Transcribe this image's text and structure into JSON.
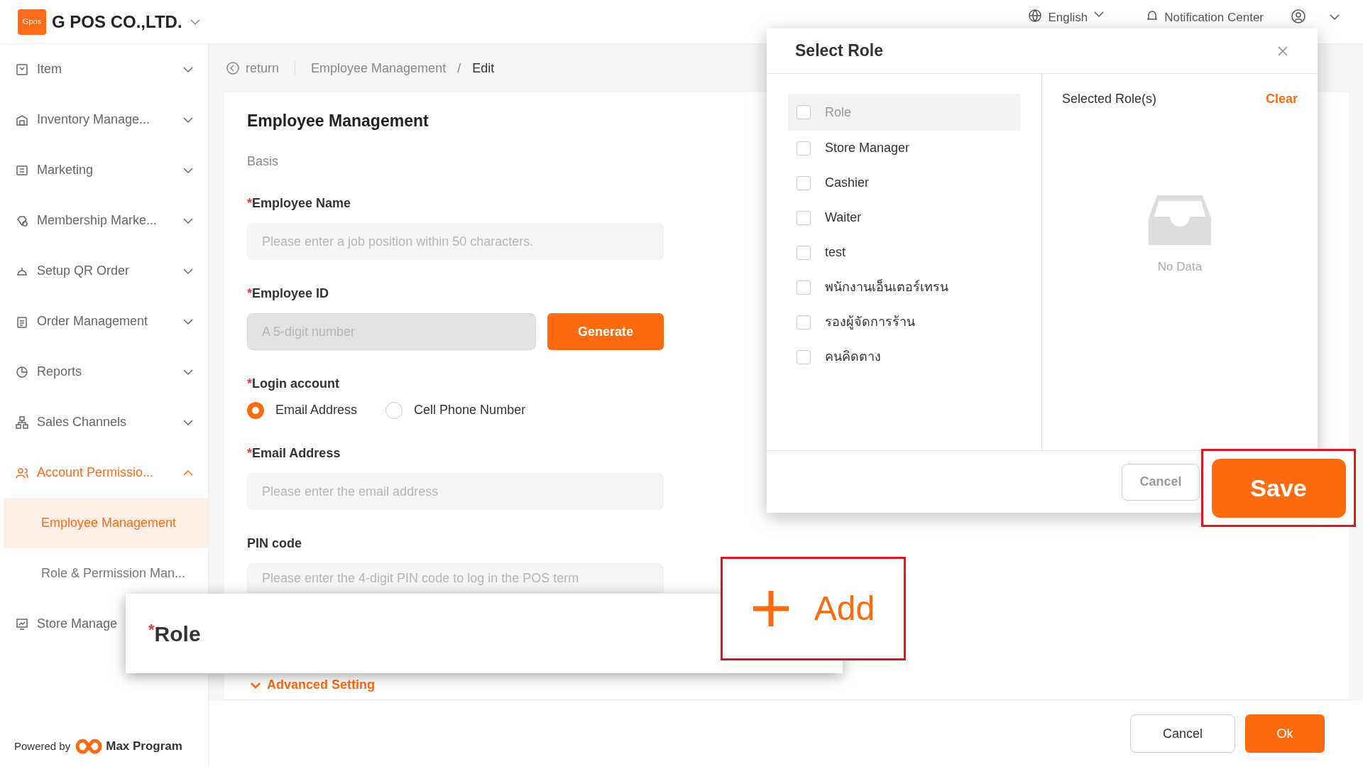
{
  "header": {
    "logo_text": "Gpos",
    "company": "G POS CO.,LTD.",
    "language": "English",
    "notification": "Notification Center"
  },
  "sidebar": {
    "items": [
      {
        "label": "Item",
        "expanded": false,
        "selected": false
      },
      {
        "label": "Inventory Manage...",
        "expanded": false,
        "selected": false
      },
      {
        "label": "Marketing",
        "expanded": false,
        "selected": false
      },
      {
        "label": "Membership Marke...",
        "expanded": false,
        "selected": false
      },
      {
        "label": "Setup QR Order",
        "expanded": false,
        "selected": false
      },
      {
        "label": "Order Management",
        "expanded": false,
        "selected": false
      },
      {
        "label": "Reports",
        "expanded": false,
        "selected": false
      },
      {
        "label": "Sales Channels",
        "expanded": false,
        "selected": false
      },
      {
        "label": "Account Permissio...",
        "expanded": true,
        "selected": true,
        "children": [
          {
            "label": "Employee Management",
            "selected": true
          },
          {
            "label": "Role & Permission Man...",
            "selected": false
          }
        ]
      },
      {
        "label": "Store Manage",
        "selected": false
      }
    ],
    "powered_by": "Powered by",
    "brand": "Max Program"
  },
  "breadcrumb": {
    "back": "return",
    "path": "Employee Management",
    "separator": "/",
    "current": "Edit"
  },
  "form": {
    "title": "Employee Management",
    "section": "Basis",
    "fields": [
      {
        "kind": "text",
        "label": "Employee Name",
        "required_mark": "*",
        "placeholder": "Please enter a job position within 50 characters.",
        "disabled": false
      },
      {
        "kind": "generate",
        "label": "Employee ID",
        "required_mark": "*",
        "placeholder": "A 5-digit number",
        "disabled": true,
        "button": "Generate"
      },
      {
        "kind": "radio",
        "label": "Login account",
        "required_mark": "*",
        "options": [
          {
            "label": "Email Address",
            "selected": true
          },
          {
            "label": "Cell Phone Number",
            "selected": false
          }
        ]
      },
      {
        "kind": "text",
        "label": "Email Address",
        "required_mark": "*",
        "placeholder": "Please enter the email address",
        "disabled": false
      },
      {
        "kind": "text",
        "label": "PIN code",
        "placeholder": "Please enter the 4-digit PIN code to log in the POS term",
        "disabled": false
      }
    ],
    "advanced": "Advanced Setting"
  },
  "footer": {
    "cancel": "Cancel",
    "ok": "Ok"
  },
  "modal": {
    "title": "Select Role",
    "roles": [
      {
        "label": "Role",
        "kind": "header",
        "checked": false
      },
      {
        "label": "Store Manager",
        "kind": "role",
        "checked": false
      },
      {
        "label": "Cashier",
        "kind": "role",
        "checked": false
      },
      {
        "label": "Waiter",
        "kind": "role",
        "checked": false
      },
      {
        "label": "test",
        "kind": "role",
        "checked": false
      },
      {
        "label": "พนักงานเอ็นเตอร์เทรน",
        "kind": "role",
        "checked": false
      },
      {
        "label": "รองผู้จัดการร้าน",
        "kind": "role",
        "checked": false
      },
      {
        "label": "คนคิดตาง",
        "kind": "role",
        "checked": false
      }
    ],
    "selected_title": "Selected Role(s)",
    "clear": "Clear",
    "empty": "No Data",
    "cancel": "Cancel",
    "save": "Save"
  },
  "callouts": {
    "role_label": "Role",
    "role_required_mark": "*",
    "add": "Add"
  }
}
